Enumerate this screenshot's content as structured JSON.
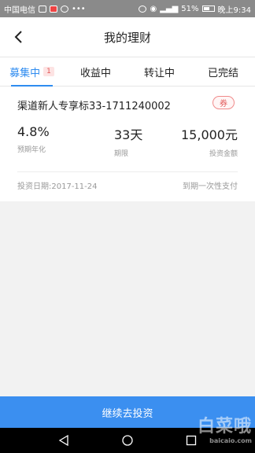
{
  "status_bar": {
    "carrier": "中国电信",
    "battery": "51%",
    "time": "晚上9:34"
  },
  "header": {
    "title": "我的理财"
  },
  "tabs": [
    {
      "label": "募集中",
      "badge": "1",
      "active": true
    },
    {
      "label": "收益中"
    },
    {
      "label": "转让中"
    },
    {
      "label": "已完结"
    }
  ],
  "investment": {
    "name": "渠道新人专享标33-1711240002",
    "coupon_label": "券",
    "rate_value": "4.8%",
    "rate_label": "预期年化",
    "term_value": "33天",
    "term_label": "期限",
    "amount_value": "15,000元",
    "amount_label": "投资金额",
    "date": "投资日期:2017-11-24",
    "repayment": "到期一次性支付"
  },
  "cta": {
    "label": "继续去投资"
  },
  "watermark": {
    "text": "白菜哦",
    "sub": "baicaio.com"
  },
  "colors": {
    "accent": "#2f8cf0",
    "button": "#3b8ff0",
    "badge_text": "#e25555"
  }
}
